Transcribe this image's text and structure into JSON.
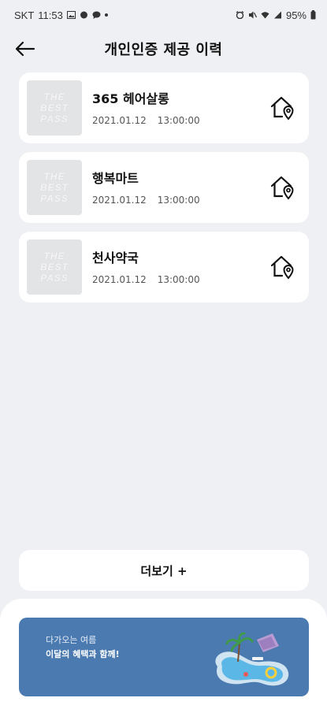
{
  "status_bar": {
    "carrier": "SKT",
    "time": "11:53",
    "battery": "95%"
  },
  "header": {
    "title": "개인인증 제공 이력"
  },
  "history": [
    {
      "store": "365 헤어살롱",
      "date": "2021.01.12",
      "time": "13:00:00",
      "logo": [
        "THE",
        "BEST",
        "PASS"
      ]
    },
    {
      "store": "행복마트",
      "date": "2021.01.12",
      "time": "13:00:00",
      "logo": [
        "THE",
        "BEST",
        "PASS"
      ]
    },
    {
      "store": "천사약국",
      "date": "2021.01.12",
      "time": "13:00:00",
      "logo": [
        "THE",
        "BEST",
        "PASS"
      ]
    }
  ],
  "more_button": {
    "label": "더보기 +"
  },
  "banner": {
    "line1": "다가오는 여름",
    "line2": "이달의 혜택과 함께!",
    "color": "#4b7ab0"
  },
  "icons": {
    "back": "arrow-left-icon",
    "location": "house-location-pin-icon"
  }
}
